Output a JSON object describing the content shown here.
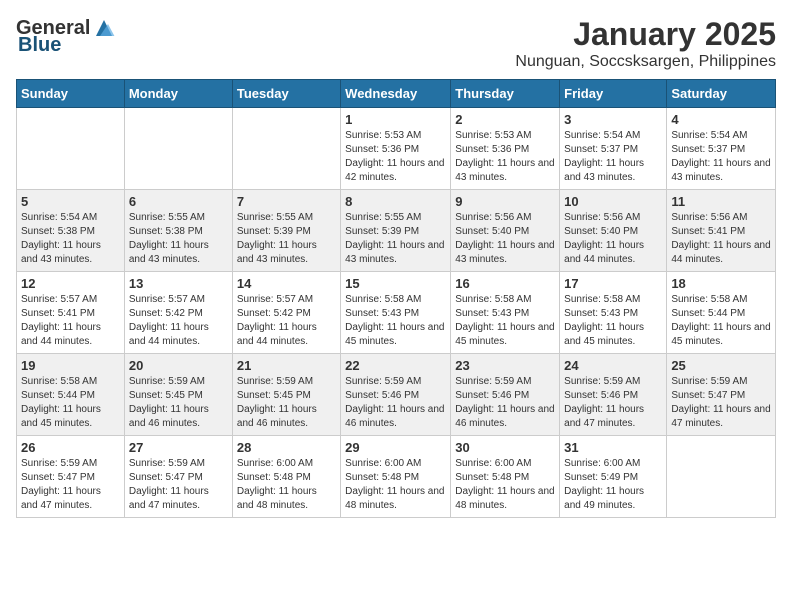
{
  "logo": {
    "general": "General",
    "blue": "Blue"
  },
  "title": "January 2025",
  "subtitle": "Nunguan, Soccsksargen, Philippines",
  "days_of_week": [
    "Sunday",
    "Monday",
    "Tuesday",
    "Wednesday",
    "Thursday",
    "Friday",
    "Saturday"
  ],
  "weeks": [
    [
      {
        "day": "",
        "sunrise": "",
        "sunset": "",
        "daylight": ""
      },
      {
        "day": "",
        "sunrise": "",
        "sunset": "",
        "daylight": ""
      },
      {
        "day": "",
        "sunrise": "",
        "sunset": "",
        "daylight": ""
      },
      {
        "day": "1",
        "sunrise": "Sunrise: 5:53 AM",
        "sunset": "Sunset: 5:36 PM",
        "daylight": "Daylight: 11 hours and 42 minutes."
      },
      {
        "day": "2",
        "sunrise": "Sunrise: 5:53 AM",
        "sunset": "Sunset: 5:36 PM",
        "daylight": "Daylight: 11 hours and 43 minutes."
      },
      {
        "day": "3",
        "sunrise": "Sunrise: 5:54 AM",
        "sunset": "Sunset: 5:37 PM",
        "daylight": "Daylight: 11 hours and 43 minutes."
      },
      {
        "day": "4",
        "sunrise": "Sunrise: 5:54 AM",
        "sunset": "Sunset: 5:37 PM",
        "daylight": "Daylight: 11 hours and 43 minutes."
      }
    ],
    [
      {
        "day": "5",
        "sunrise": "Sunrise: 5:54 AM",
        "sunset": "Sunset: 5:38 PM",
        "daylight": "Daylight: 11 hours and 43 minutes."
      },
      {
        "day": "6",
        "sunrise": "Sunrise: 5:55 AM",
        "sunset": "Sunset: 5:38 PM",
        "daylight": "Daylight: 11 hours and 43 minutes."
      },
      {
        "day": "7",
        "sunrise": "Sunrise: 5:55 AM",
        "sunset": "Sunset: 5:39 PM",
        "daylight": "Daylight: 11 hours and 43 minutes."
      },
      {
        "day": "8",
        "sunrise": "Sunrise: 5:55 AM",
        "sunset": "Sunset: 5:39 PM",
        "daylight": "Daylight: 11 hours and 43 minutes."
      },
      {
        "day": "9",
        "sunrise": "Sunrise: 5:56 AM",
        "sunset": "Sunset: 5:40 PM",
        "daylight": "Daylight: 11 hours and 43 minutes."
      },
      {
        "day": "10",
        "sunrise": "Sunrise: 5:56 AM",
        "sunset": "Sunset: 5:40 PM",
        "daylight": "Daylight: 11 hours and 44 minutes."
      },
      {
        "day": "11",
        "sunrise": "Sunrise: 5:56 AM",
        "sunset": "Sunset: 5:41 PM",
        "daylight": "Daylight: 11 hours and 44 minutes."
      }
    ],
    [
      {
        "day": "12",
        "sunrise": "Sunrise: 5:57 AM",
        "sunset": "Sunset: 5:41 PM",
        "daylight": "Daylight: 11 hours and 44 minutes."
      },
      {
        "day": "13",
        "sunrise": "Sunrise: 5:57 AM",
        "sunset": "Sunset: 5:42 PM",
        "daylight": "Daylight: 11 hours and 44 minutes."
      },
      {
        "day": "14",
        "sunrise": "Sunrise: 5:57 AM",
        "sunset": "Sunset: 5:42 PM",
        "daylight": "Daylight: 11 hours and 44 minutes."
      },
      {
        "day": "15",
        "sunrise": "Sunrise: 5:58 AM",
        "sunset": "Sunset: 5:43 PM",
        "daylight": "Daylight: 11 hours and 45 minutes."
      },
      {
        "day": "16",
        "sunrise": "Sunrise: 5:58 AM",
        "sunset": "Sunset: 5:43 PM",
        "daylight": "Daylight: 11 hours and 45 minutes."
      },
      {
        "day": "17",
        "sunrise": "Sunrise: 5:58 AM",
        "sunset": "Sunset: 5:43 PM",
        "daylight": "Daylight: 11 hours and 45 minutes."
      },
      {
        "day": "18",
        "sunrise": "Sunrise: 5:58 AM",
        "sunset": "Sunset: 5:44 PM",
        "daylight": "Daylight: 11 hours and 45 minutes."
      }
    ],
    [
      {
        "day": "19",
        "sunrise": "Sunrise: 5:58 AM",
        "sunset": "Sunset: 5:44 PM",
        "daylight": "Daylight: 11 hours and 45 minutes."
      },
      {
        "day": "20",
        "sunrise": "Sunrise: 5:59 AM",
        "sunset": "Sunset: 5:45 PM",
        "daylight": "Daylight: 11 hours and 46 minutes."
      },
      {
        "day": "21",
        "sunrise": "Sunrise: 5:59 AM",
        "sunset": "Sunset: 5:45 PM",
        "daylight": "Daylight: 11 hours and 46 minutes."
      },
      {
        "day": "22",
        "sunrise": "Sunrise: 5:59 AM",
        "sunset": "Sunset: 5:46 PM",
        "daylight": "Daylight: 11 hours and 46 minutes."
      },
      {
        "day": "23",
        "sunrise": "Sunrise: 5:59 AM",
        "sunset": "Sunset: 5:46 PM",
        "daylight": "Daylight: 11 hours and 46 minutes."
      },
      {
        "day": "24",
        "sunrise": "Sunrise: 5:59 AM",
        "sunset": "Sunset: 5:46 PM",
        "daylight": "Daylight: 11 hours and 47 minutes."
      },
      {
        "day": "25",
        "sunrise": "Sunrise: 5:59 AM",
        "sunset": "Sunset: 5:47 PM",
        "daylight": "Daylight: 11 hours and 47 minutes."
      }
    ],
    [
      {
        "day": "26",
        "sunrise": "Sunrise: 5:59 AM",
        "sunset": "Sunset: 5:47 PM",
        "daylight": "Daylight: 11 hours and 47 minutes."
      },
      {
        "day": "27",
        "sunrise": "Sunrise: 5:59 AM",
        "sunset": "Sunset: 5:47 PM",
        "daylight": "Daylight: 11 hours and 47 minutes."
      },
      {
        "day": "28",
        "sunrise": "Sunrise: 6:00 AM",
        "sunset": "Sunset: 5:48 PM",
        "daylight": "Daylight: 11 hours and 48 minutes."
      },
      {
        "day": "29",
        "sunrise": "Sunrise: 6:00 AM",
        "sunset": "Sunset: 5:48 PM",
        "daylight": "Daylight: 11 hours and 48 minutes."
      },
      {
        "day": "30",
        "sunrise": "Sunrise: 6:00 AM",
        "sunset": "Sunset: 5:48 PM",
        "daylight": "Daylight: 11 hours and 48 minutes."
      },
      {
        "day": "31",
        "sunrise": "Sunrise: 6:00 AM",
        "sunset": "Sunset: 5:49 PM",
        "daylight": "Daylight: 11 hours and 49 minutes."
      },
      {
        "day": "",
        "sunrise": "",
        "sunset": "",
        "daylight": ""
      }
    ]
  ]
}
